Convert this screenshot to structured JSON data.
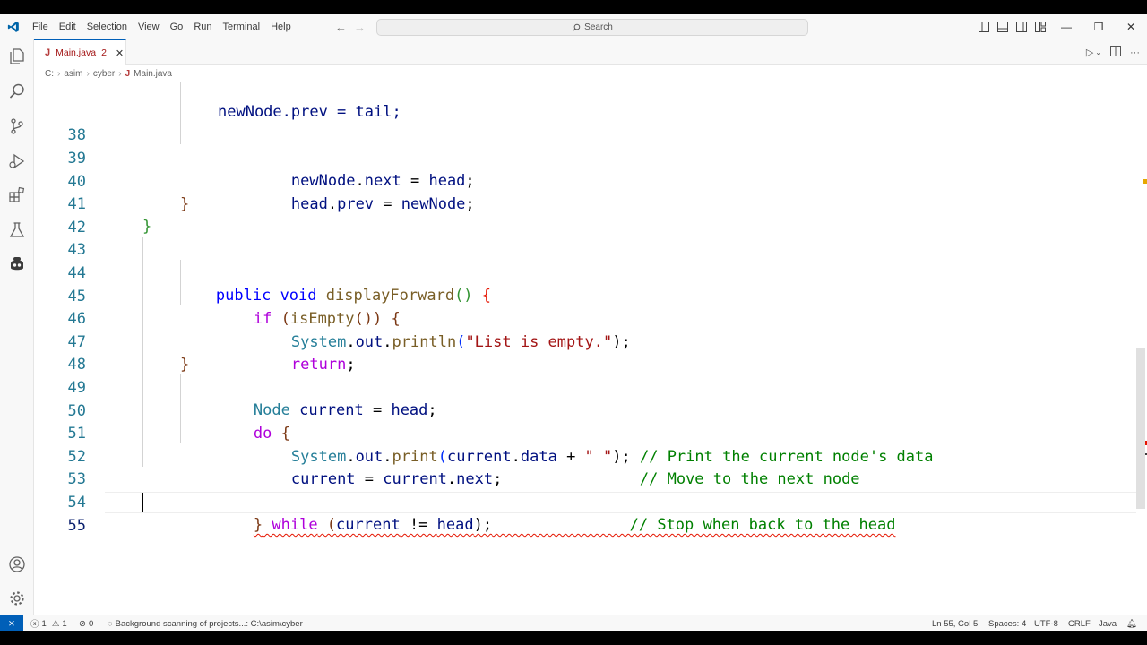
{
  "menu": [
    "File",
    "Edit",
    "Selection",
    "View",
    "Go",
    "Run",
    "Terminal",
    "Help"
  ],
  "search": {
    "label": "Search"
  },
  "tab": {
    "filename": "Main.java",
    "problems": "2"
  },
  "breadcrumb": [
    "C:",
    "asim",
    "cyber",
    "Main.java"
  ],
  "editor": {
    "lines": [
      {
        "num": "38"
      },
      {
        "num": "39"
      },
      {
        "num": "40"
      },
      {
        "num": "41"
      },
      {
        "num": "42"
      },
      {
        "num": "43"
      },
      {
        "num": "44"
      },
      {
        "num": "45"
      },
      {
        "num": "46"
      },
      {
        "num": "47"
      },
      {
        "num": "48"
      },
      {
        "num": "49"
      },
      {
        "num": "50"
      },
      {
        "num": "51"
      },
      {
        "num": "52"
      },
      {
        "num": "53"
      },
      {
        "num": "54"
      },
      {
        "num": "55"
      }
    ],
    "code": {
      "l37": "newNode.prev = tail;",
      "l38_a": "newNode",
      "l38_b": ".",
      "l38_c": "next",
      "l38_d": " = ",
      "l38_e": "head",
      "l38_f": ";",
      "l39_a": "head",
      "l39_b": ".",
      "l39_c": "prev",
      "l39_d": " = ",
      "l39_e": "newNode",
      "l39_f": ";",
      "l40": "}",
      "l41": "}",
      "l43_kw1": "public",
      "l43_kw2": "void",
      "l43_fn": "displayForward",
      "l43_p": "()",
      "l43_b": "{",
      "l44_kw": "if",
      "l44_p1": " (",
      "l44_fn": "isEmpty",
      "l44_p2": "())",
      "l44_b": " {",
      "l45_a": "System",
      "l45_b": ".",
      "l45_c": "out",
      "l45_d": ".",
      "l45_fn": "println",
      "l45_p1": "(",
      "l45_str": "\"List is empty.\"",
      "l45_p2": ");",
      "l46_kw": "return",
      "l46_s": ";",
      "l47": "}",
      "l48_ty": "Node",
      "l48_a": " current",
      "l48_b": " = ",
      "l48_c": "head",
      "l48_d": ";",
      "l49_kw": "do",
      "l49_b": " {",
      "l50_a": "System",
      "l50_b": ".",
      "l50_c": "out",
      "l50_d": ".",
      "l50_fn": "print",
      "l50_p1": "(",
      "l50_v1": "current",
      "l50_e": ".",
      "l50_v2": "data",
      "l50_f": " + ",
      "l50_str": "\" \"",
      "l50_p2": ");",
      "l50_cm": " // Print the current node's data",
      "l51_a": "current",
      "l51_b": " = ",
      "l51_c": "current",
      "l51_d": ".",
      "l51_e": "next",
      "l51_f": ";",
      "l51_cm": "               // Move to the next node",
      "l53_b": "}",
      "l53_kw": " while",
      "l53_p1": " (",
      "l53_a": "current",
      "l53_op": " != ",
      "l53_c": "head",
      "l53_p2": ");",
      "l53_cm": "               // Stop when back to the head"
    }
  },
  "status": {
    "errors": "1",
    "warnings": "1",
    "ports": "0",
    "scan": "Background scanning of projects...: C:\\asim\\cyber",
    "position": "Ln 55, Col 5",
    "spaces": "Spaces: 4",
    "encoding": "UTF-8",
    "eol": "CRLF",
    "language": "Java"
  },
  "colors": {
    "accent": "#005fb8",
    "keyword": "#0000ff",
    "control": "#af00db",
    "function": "#795e26",
    "type": "#267f99",
    "string": "#a31515",
    "comment": "#008000",
    "variable": "#001080",
    "lineNumber": "#237893"
  }
}
